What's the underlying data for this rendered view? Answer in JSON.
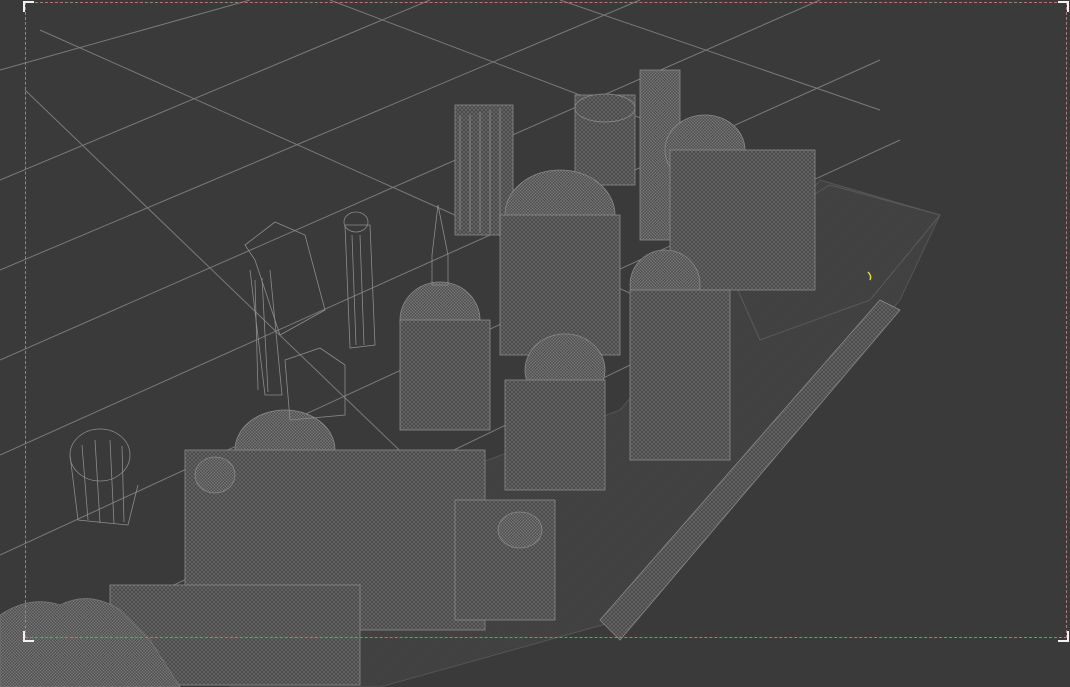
{
  "viewport": {
    "mode": "wireframe",
    "background_color": "#3a3a3a",
    "grid_color": "#7a7a7a",
    "wire_color": "#8a8a8a",
    "frame_color": "#b07878",
    "corner_color": "#f2f2f2",
    "highlight_color": "#d7e34a"
  }
}
